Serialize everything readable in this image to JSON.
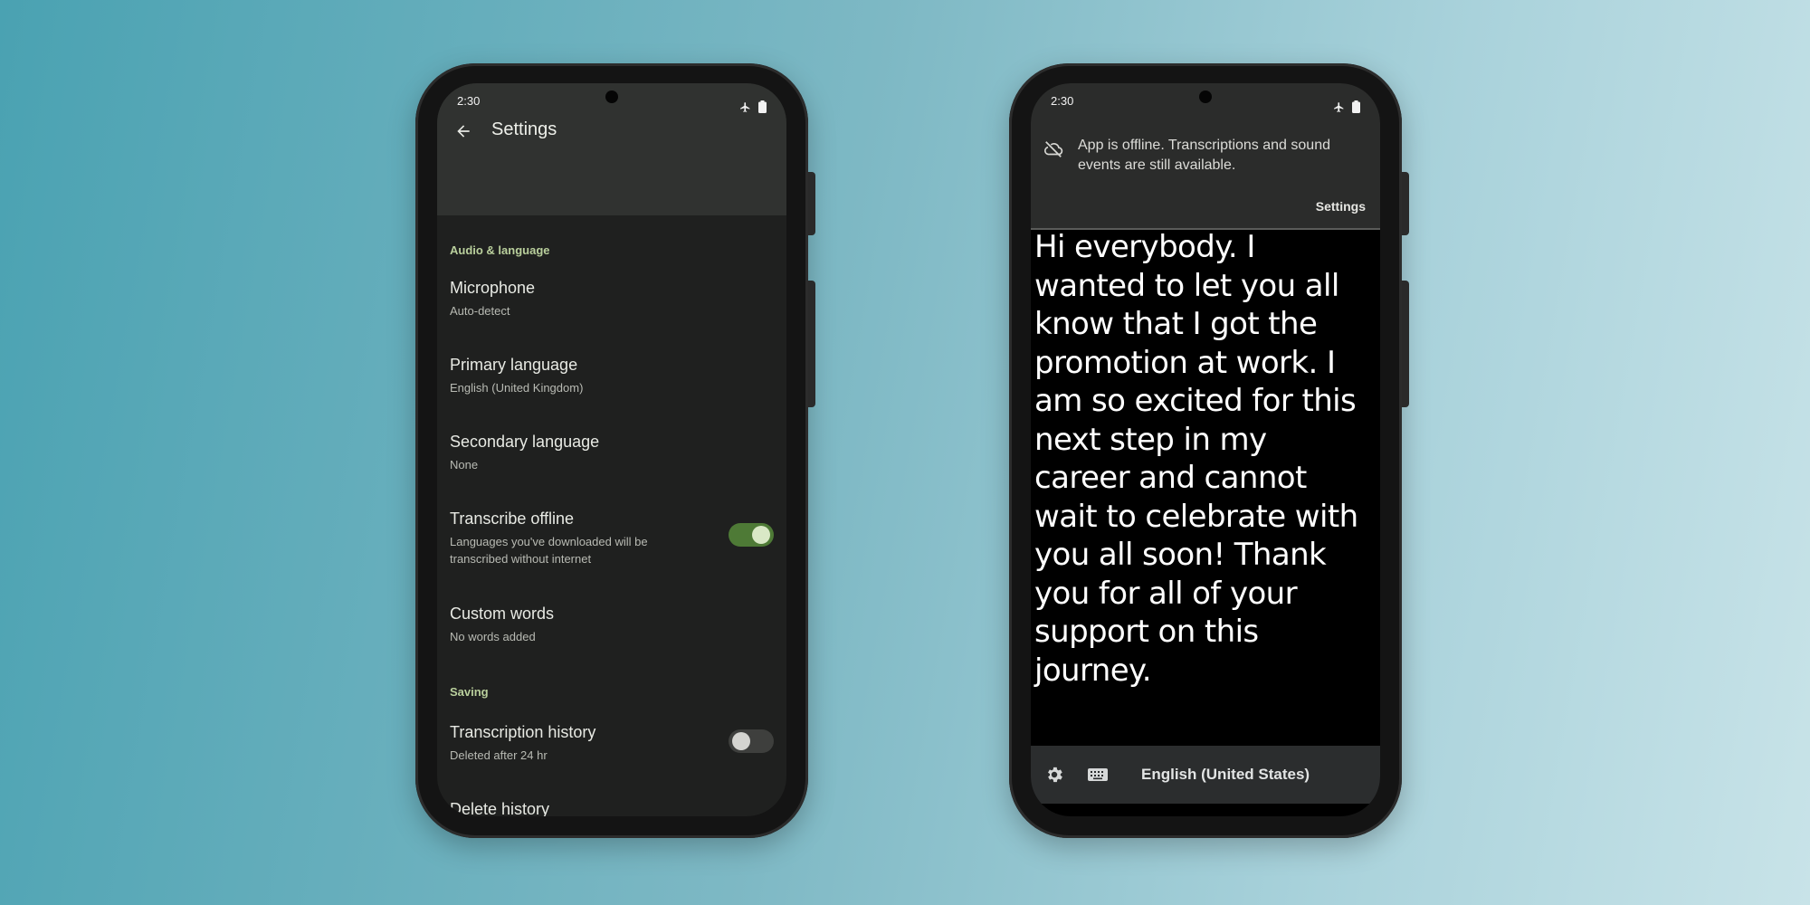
{
  "left_phone": {
    "status": {
      "time": "2:30"
    },
    "appbar": {
      "title": "Settings"
    },
    "sections": [
      {
        "title": "Audio & language"
      },
      {
        "title": "Saving"
      }
    ],
    "prefs": {
      "microphone": {
        "title": "Microphone",
        "summary": "Auto-detect"
      },
      "primary_language": {
        "title": "Primary language",
        "summary": "English (United Kingdom)"
      },
      "secondary_language": {
        "title": "Secondary language",
        "summary": "None"
      },
      "transcribe_offline": {
        "title": "Transcribe offline",
        "summary": "Languages you've downloaded will be transcribed without internet",
        "enabled": true
      },
      "custom_words": {
        "title": "Custom words",
        "summary": "No words added"
      },
      "transcription_history": {
        "title": "Transcription history",
        "summary": "Deleted after 24 hr",
        "enabled": false
      },
      "delete_history": {
        "title": "Delete history"
      }
    }
  },
  "right_phone": {
    "status": {
      "time": "2:30"
    },
    "banner": {
      "message": "App is offline. Transcriptions and sound events are still available.",
      "action": "Settings",
      "icon": "cloud-off-icon"
    },
    "transcript": "Hi everybody. I wanted to let you all know that I got the promotion at work. I am so excited for this next step in my career and cannot wait to celebrate with you all soon! Thank you for all of your support on this journey.",
    "bottom_bar": {
      "language": "English (United States)",
      "icons": [
        "gear-icon",
        "keyboard-icon"
      ]
    }
  },
  "colors": {
    "accent_green": "#4e7a36",
    "section_title": "#b9cf9c",
    "settings_bg": "#1f201f",
    "transcript_bg": "#000000"
  }
}
